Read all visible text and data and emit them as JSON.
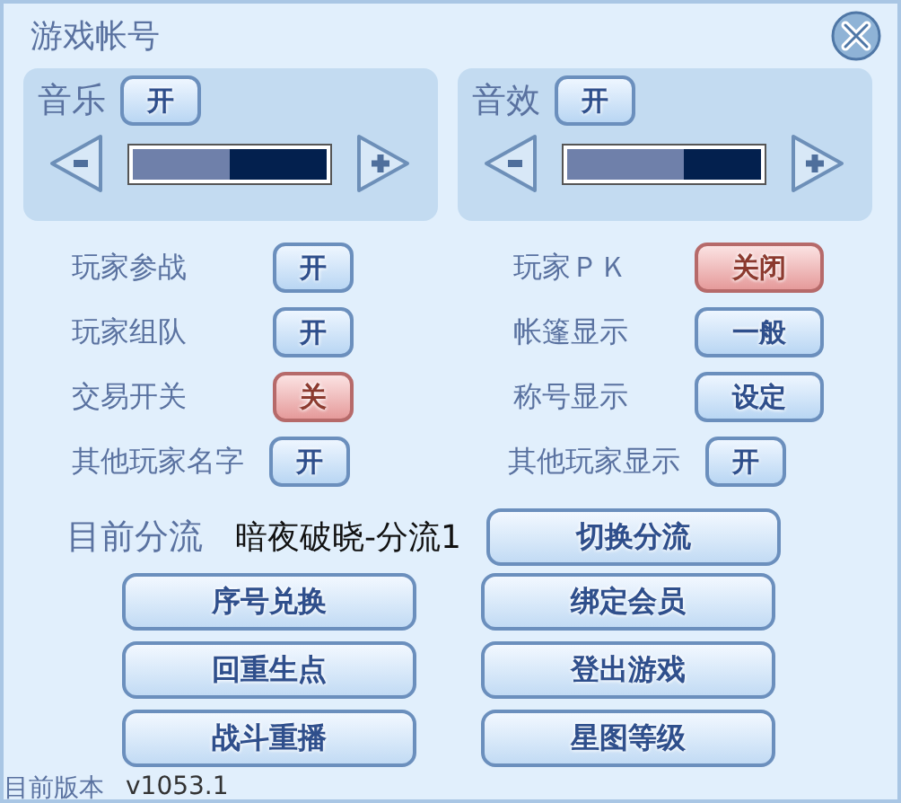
{
  "window": {
    "title": "游戏帐号"
  },
  "audio": [
    {
      "label": "音乐",
      "toggle": "开",
      "on": true,
      "level": 0.5
    },
    {
      "label": "音效",
      "toggle": "开",
      "on": true,
      "level": 0.6
    }
  ],
  "settings": [
    {
      "label": "玩家参战",
      "kind": "toggle",
      "value": "开",
      "on": true
    },
    {
      "label": "玩家ＰＫ",
      "kind": "toggle",
      "value": "关闭",
      "on": false
    },
    {
      "label": "玩家组队",
      "kind": "toggle",
      "value": "开",
      "on": true
    },
    {
      "label": "帐篷显示",
      "kind": "option",
      "value": "一般"
    },
    {
      "label": "交易开关",
      "kind": "toggle",
      "value": "关",
      "on": false
    },
    {
      "label": "称号显示",
      "kind": "option",
      "value": "设定"
    },
    {
      "label": "其他玩家名字",
      "kind": "toggle",
      "value": "开",
      "on": true
    },
    {
      "label": "其他玩家显示",
      "kind": "toggle",
      "value": "开",
      "on": true
    }
  ],
  "server": {
    "label": "目前分流",
    "value": "暗夜破晓-分流1",
    "button": "切换分流"
  },
  "buttons": [
    "序号兑换",
    "绑定会员",
    "回重生点",
    "登出游戏",
    "战斗重播",
    "星图等级"
  ],
  "version": {
    "label": "目前版本",
    "value": "v1053.1"
  }
}
